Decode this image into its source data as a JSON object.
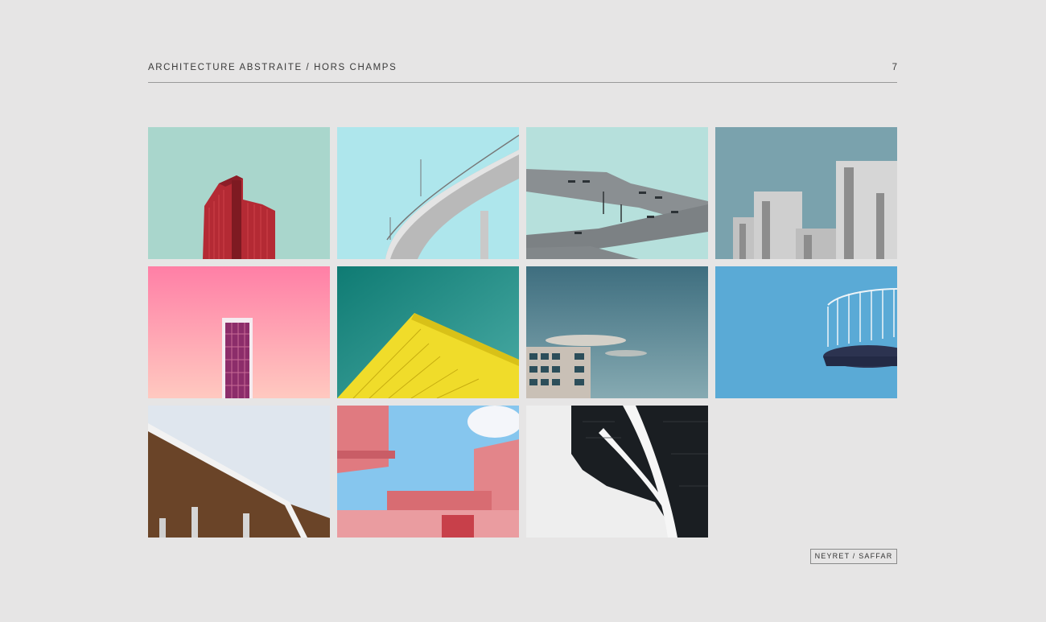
{
  "header": {
    "title": "ARCHITECTURE ABSTRAITE / HORS CHAMPS",
    "page_number": "7"
  },
  "footer": {
    "credit": "NEYRET / SAFFAR"
  },
  "gallery": {
    "count": 11
  }
}
